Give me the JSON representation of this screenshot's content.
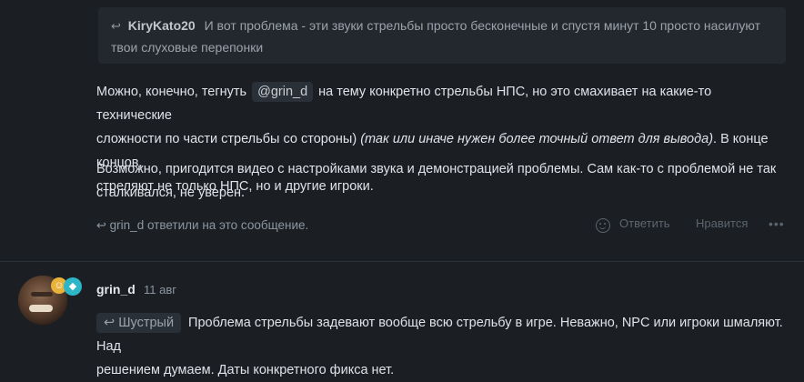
{
  "quote": {
    "author": "KiryKato20",
    "line1": "И вот проблема - эти звуки стрельбы просто бесконечные и спустя минут 10 просто насилуют",
    "line2": "твои слуховые перепонки"
  },
  "post1": {
    "p1_before": "Можно, конечно, тегнуть",
    "mention": "@grin_d",
    "p1_after": "на тему конкретно стрельбы НПС, но это смахивает на какие-то технические",
    "p1_line2_before": "сложности по части стрельбы со стороны)",
    "p1_italic": "(так или иначе нужен более точный ответ для вывода)",
    "p1_line2_after": ". В конце концов,",
    "p1_line3": "стреляют не только НПС, но и другие игроки.",
    "p2_line1": "Возможно, пригодится видео с настройками звука и демонстрацией проблемы. Сам как-то с проблемой не так",
    "p2_line2": "сталкивался, не уверен.",
    "replied_text": "grin_d ответили на это сообщение.",
    "actions": {
      "reply": "Ответить",
      "like": "Нравится",
      "more": "•••"
    }
  },
  "post2": {
    "username": "grin_d",
    "date": "11 авг",
    "reply_to": "Шустрый",
    "text_line1": "Проблема стрельбы задевают вообще всю стрельбу в игре. Неважно, NPC или игроки шмаляют. Над",
    "text_line2": "решением думаем. Даты конкретного фикса нет."
  },
  "colors": {
    "background": "#1b1f24",
    "quote_bg": "#23282e",
    "badge_gold": "#e9b23a",
    "badge_cyan": "#2db6c6"
  },
  "icons": {
    "reply": "reply-arrow-icon",
    "emoji": "emoji-icon",
    "more": "more-icon",
    "badge1": "gold-badge-icon",
    "badge2": "diamond-badge-icon"
  }
}
